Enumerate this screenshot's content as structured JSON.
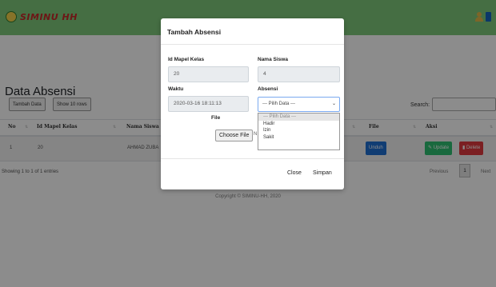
{
  "navbar": {
    "brand": "SIMINU HH",
    "icons": [
      "user-icon",
      "logout-icon"
    ]
  },
  "page": {
    "title": "Data Absensi",
    "tambah_label": "Tambah Data",
    "show_label": "Show 10 rows",
    "search_label": "Search:",
    "search_value": ""
  },
  "table": {
    "columns": [
      "No",
      "Id Mapel Kelas",
      "Nama Siswa",
      "File",
      "Aksi"
    ],
    "rows": [
      {
        "no": "1",
        "id_mapel_kelas": "20",
        "nama_siswa": "AHMAD ZUBA",
        "file_action": "Unduh",
        "update_label": "Update",
        "delete_label": "Delete"
      }
    ],
    "info": "Showing 1 to 1 of 1 entries",
    "pagination": {
      "prev": "Previous",
      "page": "1",
      "next": "Next"
    }
  },
  "footer": {
    "text": "Copyright © SIMINU-HH, 2020"
  },
  "modal": {
    "title": "Tambah Absensi",
    "id_mapel_label": "Id Mapel Kelas",
    "id_mapel_value": "20",
    "nama_siswa_label": "Nama Siswa",
    "nama_siswa_value": "4",
    "waktu_label": "Waktu",
    "waktu_value": "2020-03-16 18:11:13",
    "absensi_label": "Absensi",
    "absensi_selected": "--- Pilih Data ---",
    "absensi_options": [
      "--- Pilih Data ---",
      "Hadir",
      "Izin",
      "Sakit"
    ],
    "file_label": "File",
    "choose_file_label": "Choose File",
    "file_status": "N",
    "close_label": "Close",
    "save_label": "Simpan"
  },
  "colors": {
    "navbar": "#7fc97a",
    "unduh": "#1f6fd1",
    "update": "#2fbf71",
    "delete": "#e0393e"
  }
}
